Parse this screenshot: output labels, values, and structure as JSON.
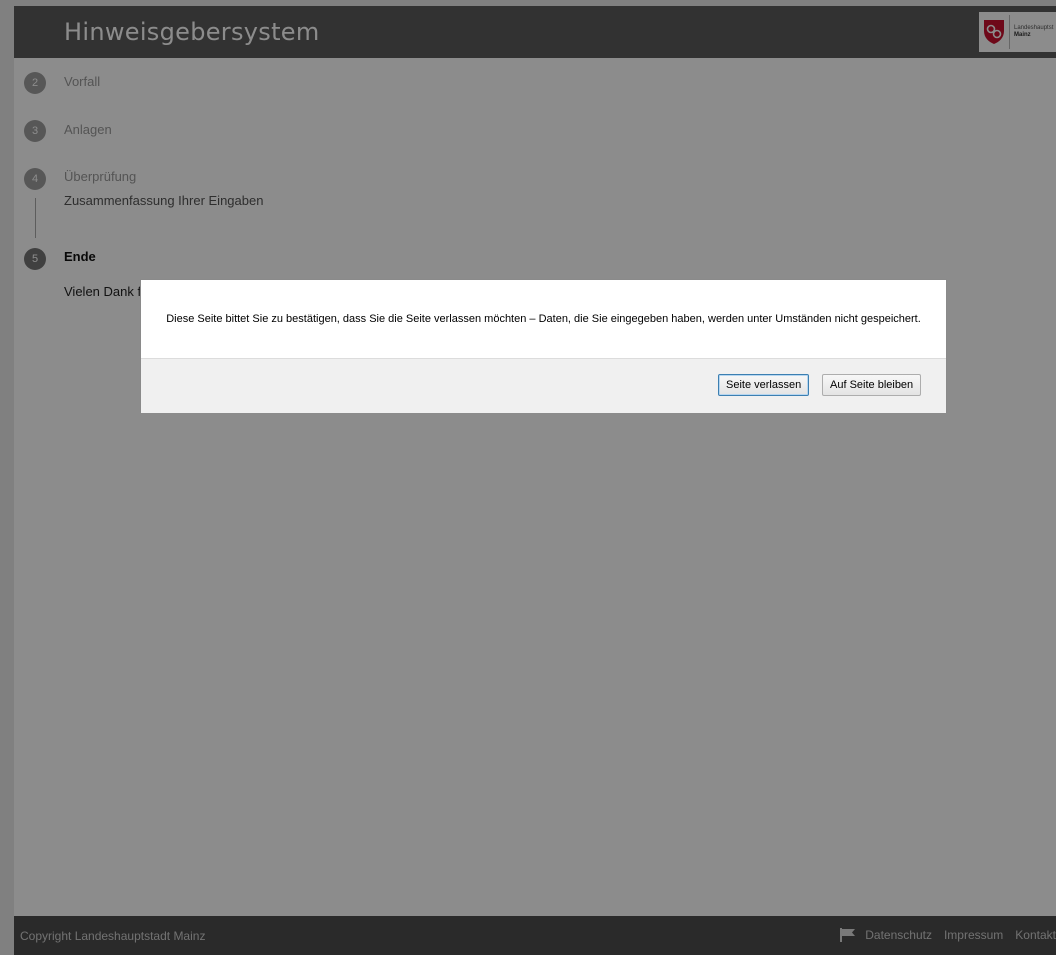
{
  "header": {
    "title": "Hinweisgebersystem",
    "logo_line1": "Landeshauptst",
    "logo_line2": "Mainz"
  },
  "steps": [
    {
      "number": "2",
      "label": "Vorfall"
    },
    {
      "number": "3",
      "label": "Anlagen"
    },
    {
      "number": "4",
      "label": "Überprüfung",
      "sub": "Zusammenfassung Ihrer Eingaben"
    },
    {
      "number": "5",
      "label": "Ende",
      "sub": "Vielen Dank fü"
    }
  ],
  "dialog": {
    "message": "Diese Seite bittet Sie zu bestätigen, dass Sie die Seite verlassen möchten – Daten, die Sie eingegeben haben, werden unter Umständen nicht gespeichert.",
    "leave_label": "Seite verlassen",
    "stay_label": "Auf Seite bleiben"
  },
  "footer": {
    "copyright": "Copyright Landeshauptstadt Mainz",
    "links": [
      "Datenschutz",
      "Impressum",
      "Kontakt"
    ]
  },
  "colors": {
    "header_bg": "#5b5b5b",
    "footer_bg": "#4e4e4e",
    "logo_red": "#c8102e"
  }
}
